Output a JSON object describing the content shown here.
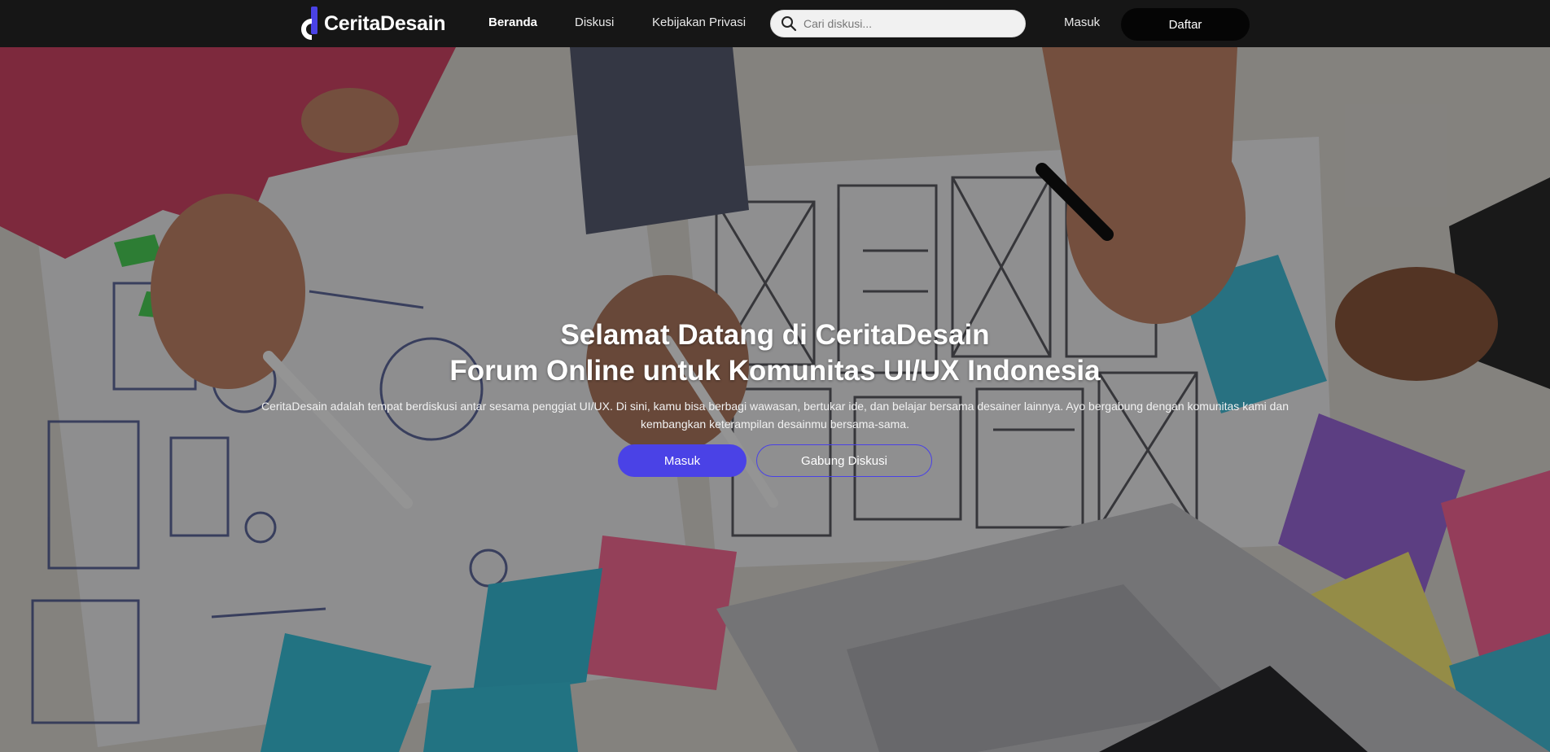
{
  "brand": {
    "name": "CeritaDesain",
    "accent": "#4a42e6"
  },
  "nav": {
    "links": [
      {
        "label": "Beranda",
        "active": true
      },
      {
        "label": "Diskusi",
        "active": false
      },
      {
        "label": "Kebijakan Privasi",
        "active": false
      }
    ],
    "search": {
      "placeholder": "Cari diskusi...",
      "value": "",
      "icon": "search-icon"
    },
    "login_label": "Masuk",
    "register_label": "Daftar"
  },
  "hero": {
    "title_line1": "Selamat Datang di CeritaDesain",
    "title_line2": "Forum Online untuk Komunitas UI/UX Indonesia",
    "description": "CeritaDesain adalah tempat berdiskusi antar sesama penggiat UI/UX. Di sini, kamu bisa berbagi wawasan, bertukar ide, dan belajar bersama desainer lainnya. Ayo bergabung dengan komunitas kami dan kembangkan keterampilan desainmu bersama-sama.",
    "primary_button": "Masuk",
    "secondary_button": "Gabung Diskusi",
    "background_image": "team-sketching-wireframes-photo"
  },
  "colors": {
    "navbar_bg": "#161616",
    "primary": "#4a42e6",
    "daftar_bg": "#050505"
  }
}
